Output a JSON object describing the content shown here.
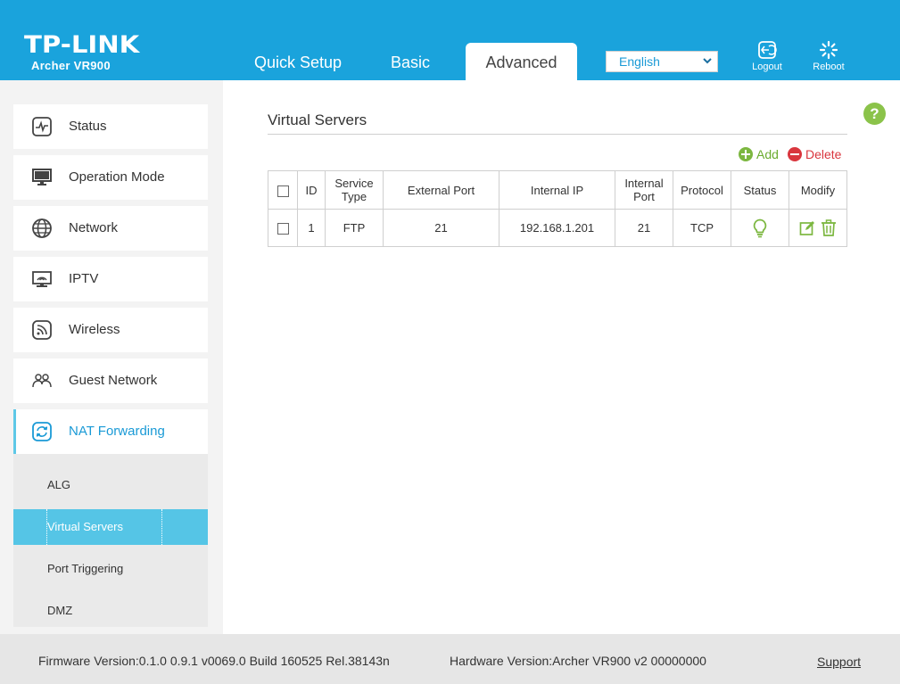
{
  "brand": {
    "logo": "TP-LINK",
    "model": "Archer VR900"
  },
  "nav": {
    "tabs": [
      {
        "label": "Quick Setup"
      },
      {
        "label": "Basic"
      },
      {
        "label": "Advanced"
      }
    ],
    "active_tab": "Advanced"
  },
  "language": {
    "selected": "English"
  },
  "header_actions": {
    "logout": "Logout",
    "reboot": "Reboot"
  },
  "sidebar": {
    "items": [
      {
        "label": "Status",
        "icon": "status-icon"
      },
      {
        "label": "Operation Mode",
        "icon": "monitor-icon"
      },
      {
        "label": "Network",
        "icon": "globe-icon"
      },
      {
        "label": "IPTV",
        "icon": "tv-icon"
      },
      {
        "label": "Wireless",
        "icon": "wireless-icon"
      },
      {
        "label": "Guest Network",
        "icon": "guest-icon"
      },
      {
        "label": "NAT Forwarding",
        "icon": "nat-icon"
      }
    ],
    "active_item": "NAT Forwarding",
    "subitems": [
      {
        "label": "ALG"
      },
      {
        "label": "Virtual Servers"
      },
      {
        "label": "Port Triggering"
      },
      {
        "label": "DMZ"
      }
    ],
    "active_subitem": "Virtual Servers"
  },
  "main": {
    "title": "Virtual Servers",
    "help": "?",
    "actions": {
      "add": "Add",
      "delete": "Delete"
    },
    "table": {
      "headers": [
        "",
        "ID",
        "Service Type",
        "External Port",
        "Internal IP",
        "Internal Port",
        "Protocol",
        "Status",
        "Modify"
      ],
      "rows": [
        {
          "id": "1",
          "service_type": "FTP",
          "external_port": "21",
          "internal_ip": "192.168.1.201",
          "internal_port": "21",
          "protocol": "TCP",
          "status": "enabled"
        }
      ]
    }
  },
  "footer": {
    "firmware": "Firmware Version:0.1.0 0.9.1 v0069.0 Build 160525 Rel.38143n",
    "hardware": "Hardware Version:Archer VR900 v2 00000000",
    "support": "Support"
  },
  "colors": {
    "header": "#1aa3dc",
    "accent": "#1a9ad6",
    "active_sub": "#55c5e6",
    "green": "#7cb740",
    "red": "#d9363e"
  }
}
